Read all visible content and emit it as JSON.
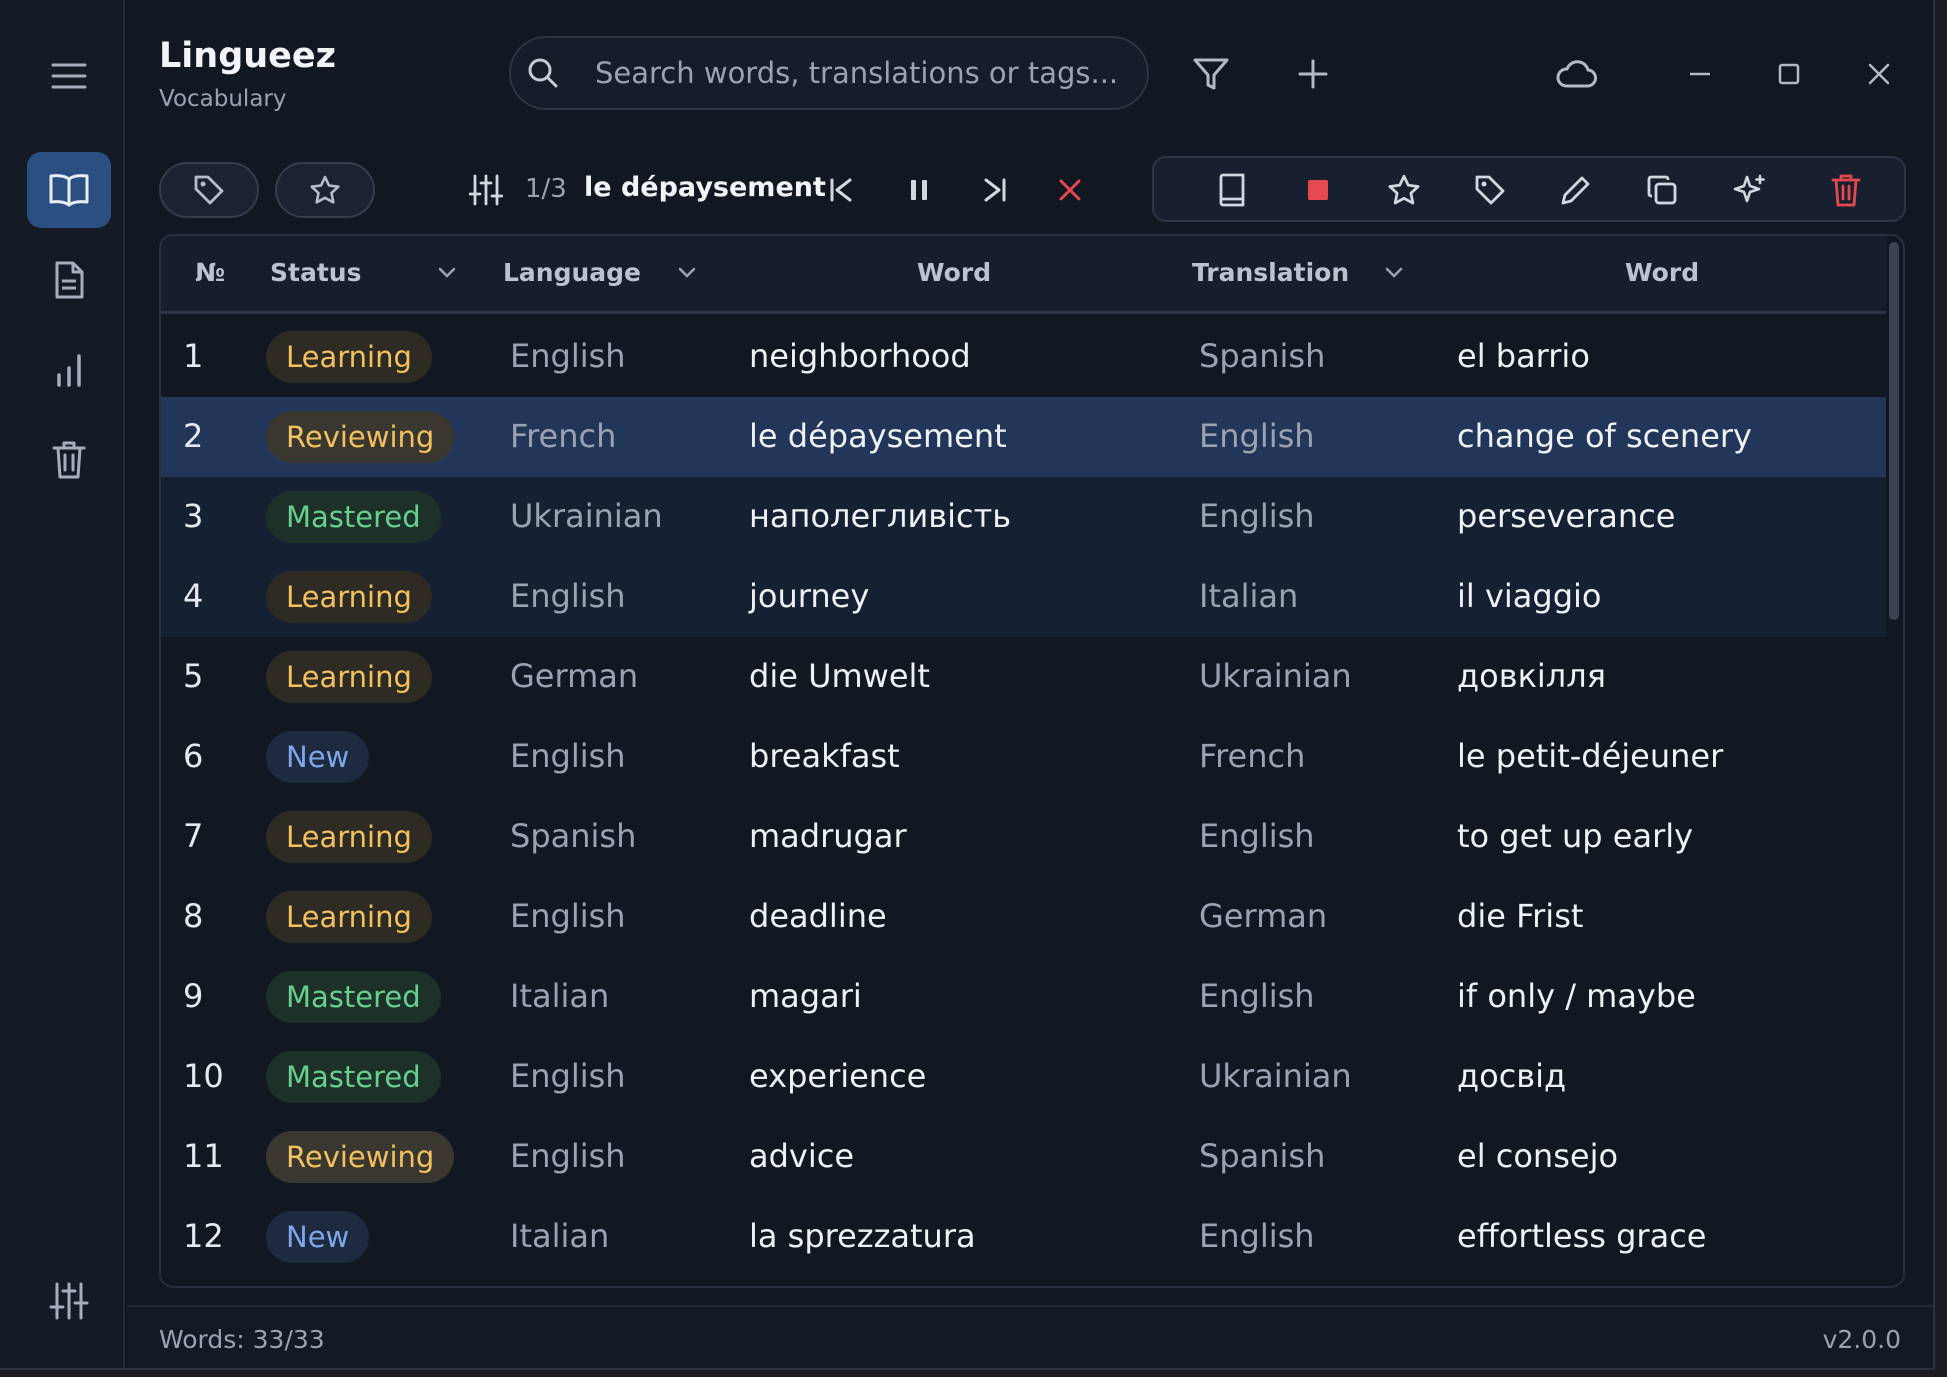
{
  "app": {
    "title": "Lingueez",
    "subtitle": "Vocabulary"
  },
  "sidebar": {
    "items": [
      {
        "icon": "book-icon",
        "active": true
      },
      {
        "icon": "document-icon",
        "active": false
      },
      {
        "icon": "bar-chart-icon",
        "active": false
      },
      {
        "icon": "trash-icon",
        "active": false
      }
    ],
    "bottom_icon": "sliders-icon"
  },
  "search": {
    "placeholder": "Search words, translations or tags..."
  },
  "header_icons": [
    "filter-icon",
    "plus-icon",
    "cloud-icon",
    "minimize-icon",
    "maximize-icon",
    "close-icon"
  ],
  "playback": {
    "counter": "1/3",
    "current_word": "le dépaysement"
  },
  "action_icons": [
    "book-icon",
    "stop-icon",
    "star-icon",
    "tag-icon",
    "pencil-icon",
    "copy-icon",
    "sparkle-icon",
    "delete-icon"
  ],
  "colors": {
    "accent": "#2b4f80",
    "selected_row": "#22365a",
    "learning": "#f1c25f",
    "reviewing": "#f1c25f",
    "mastered": "#67d08f",
    "new": "#7fa6ea",
    "danger": "#e5484d"
  },
  "table": {
    "headers": {
      "num": "№",
      "status": "Status",
      "language": "Language",
      "word": "Word",
      "translation": "Translation",
      "translation_word": "Word"
    },
    "rows": [
      {
        "num": "1",
        "status": "Learning",
        "language": "English",
        "word": "neighborhood",
        "tlang": "Spanish",
        "tword": "el barrio"
      },
      {
        "num": "2",
        "status": "Reviewing",
        "language": "French",
        "word": "le dépaysement",
        "tlang": "English",
        "tword": "change of scenery"
      },
      {
        "num": "3",
        "status": "Mastered",
        "language": "Ukrainian",
        "word": "наполегливість",
        "tlang": "English",
        "tword": "perseverance"
      },
      {
        "num": "4",
        "status": "Learning",
        "language": "English",
        "word": "journey",
        "tlang": "Italian",
        "tword": "il viaggio"
      },
      {
        "num": "5",
        "status": "Learning",
        "language": "German",
        "word": "die Umwelt",
        "tlang": "Ukrainian",
        "tword": "довкілля"
      },
      {
        "num": "6",
        "status": "New",
        "language": "English",
        "word": "breakfast",
        "tlang": "French",
        "tword": "le petit-déjeuner"
      },
      {
        "num": "7",
        "status": "Learning",
        "language": "Spanish",
        "word": "madrugar",
        "tlang": "English",
        "tword": "to get up early"
      },
      {
        "num": "8",
        "status": "Learning",
        "language": "English",
        "word": "deadline",
        "tlang": "German",
        "tword": "die Frist"
      },
      {
        "num": "9",
        "status": "Mastered",
        "language": "Italian",
        "word": "magari",
        "tlang": "English",
        "tword": "if only / maybe"
      },
      {
        "num": "10",
        "status": "Mastered",
        "language": "English",
        "word": "experience",
        "tlang": "Ukrainian",
        "tword": "досвід"
      },
      {
        "num": "11",
        "status": "Reviewing",
        "language": "English",
        "word": "advice",
        "tlang": "Spanish",
        "tword": "el consejo"
      },
      {
        "num": "12",
        "status": "New",
        "language": "Italian",
        "word": "la sprezzatura",
        "tlang": "English",
        "tword": "effortless grace"
      }
    ]
  },
  "status_bar": {
    "words": "Words: 33/33",
    "version": "v2.0.0"
  }
}
